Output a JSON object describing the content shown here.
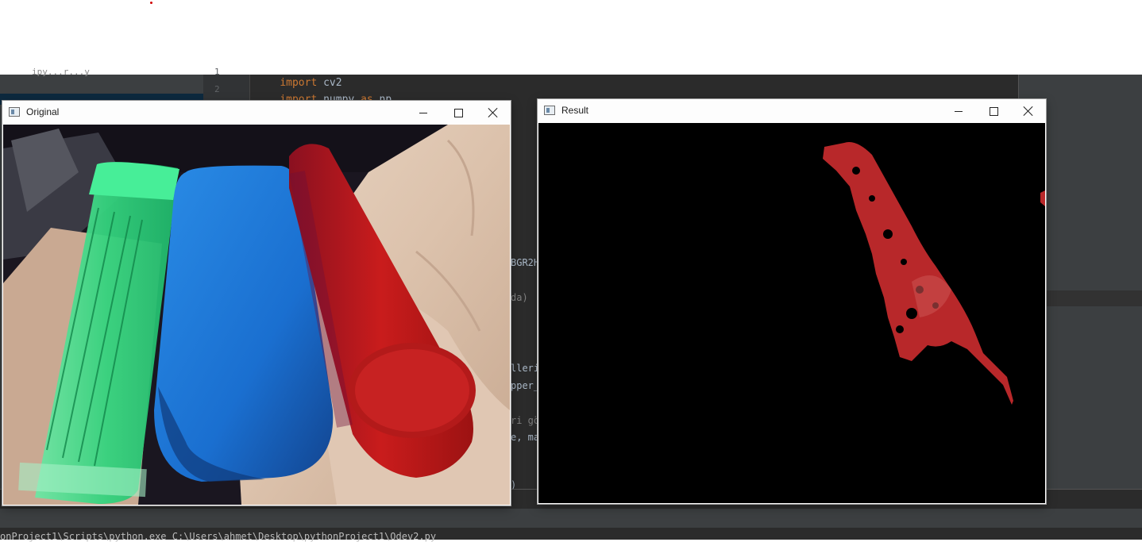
{
  "ide": {
    "project_tree_snippet": "ipy...r...y",
    "code_lines": [
      {
        "number": "1",
        "tokens": [
          {
            "text": "import",
            "kind": "kw"
          },
          {
            "text": " cv2",
            "kind": "id"
          }
        ]
      },
      {
        "number": "2",
        "tokens": [
          {
            "text": "import",
            "kind": "kw"
          },
          {
            "text": " numpy ",
            "kind": "id"
          },
          {
            "text": "as",
            "kind": "kw"
          },
          {
            "text": " np",
            "kind": "id"
          }
        ]
      }
    ],
    "peek_fragments": [
      "BGR2H",
      "da)",
      "lleri",
      "pper_",
      "ri gö",
      "e, ma",
      ")"
    ],
    "run_command": "onProject1\\Scripts\\python.exe C:\\Users\\ahmet\\Desktop\\pythonProject1\\Odev2.py"
  },
  "windows": {
    "original": {
      "title": "Original"
    },
    "result": {
      "title": "Result"
    }
  },
  "icons": {
    "app": "opencv-window-icon",
    "minimize": "minimize-icon",
    "maximize": "maximize-icon",
    "close": "close-icon"
  },
  "colors": {
    "ide_bg": "#2b2b2b",
    "keyword": "#cc7832",
    "identifier": "#a9b7c6",
    "mask_red": "#b8282a",
    "blue_object": "#1e78d8",
    "green_object": "#3fe08a",
    "red_object": "#c01d1d"
  }
}
